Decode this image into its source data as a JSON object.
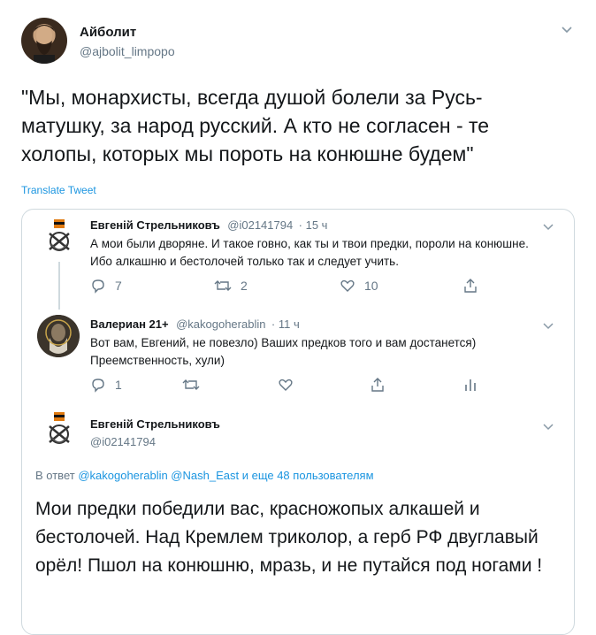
{
  "main": {
    "author_name": "Айболит",
    "author_handle": "@ajbolit_limpopo",
    "text": "\"Мы, монархисты, всегда душой болели за Русь-матушку, за народ русский. А кто не согласен - те холопы, которых мы пороть на конюшне будем\"",
    "translate": "Translate Tweet"
  },
  "q1": {
    "name": "Евгенiй Стрельниковъ",
    "handle": "@i02141794",
    "time": "· 15 ч",
    "text": "А мои были дворяне. И такое говно, как ты и твои предки, пороли на конюшне. Ибо алкашню и бестолочей только так и следует учить.",
    "replies": "7",
    "retweets": "2",
    "likes": "10"
  },
  "q2": {
    "name": "Валериан 21+",
    "handle": "@kakogoherablin",
    "time": "· 11 ч",
    "text": "Вот вам, Евгений, не повезло) Ваших предков того и вам достанется) Преемственность, хули)",
    "replies": "1"
  },
  "q3": {
    "name": "Евгенiй Стрельниковъ",
    "handle": "@i02141794",
    "reply_prefix": "В ответ",
    "reply_users": "@kakogoherablin @Nash_East и еще 48 пользователям",
    "text": "Мои предки победили вас, красножопых алкашей и бестолочей. Над Кремлем триколор, а герб РФ двуглавый орёл! Пшол на конюшню, мразь, и не путайся под ногами !"
  },
  "colors": {
    "link": "#1b95e0",
    "muted": "#657786"
  }
}
